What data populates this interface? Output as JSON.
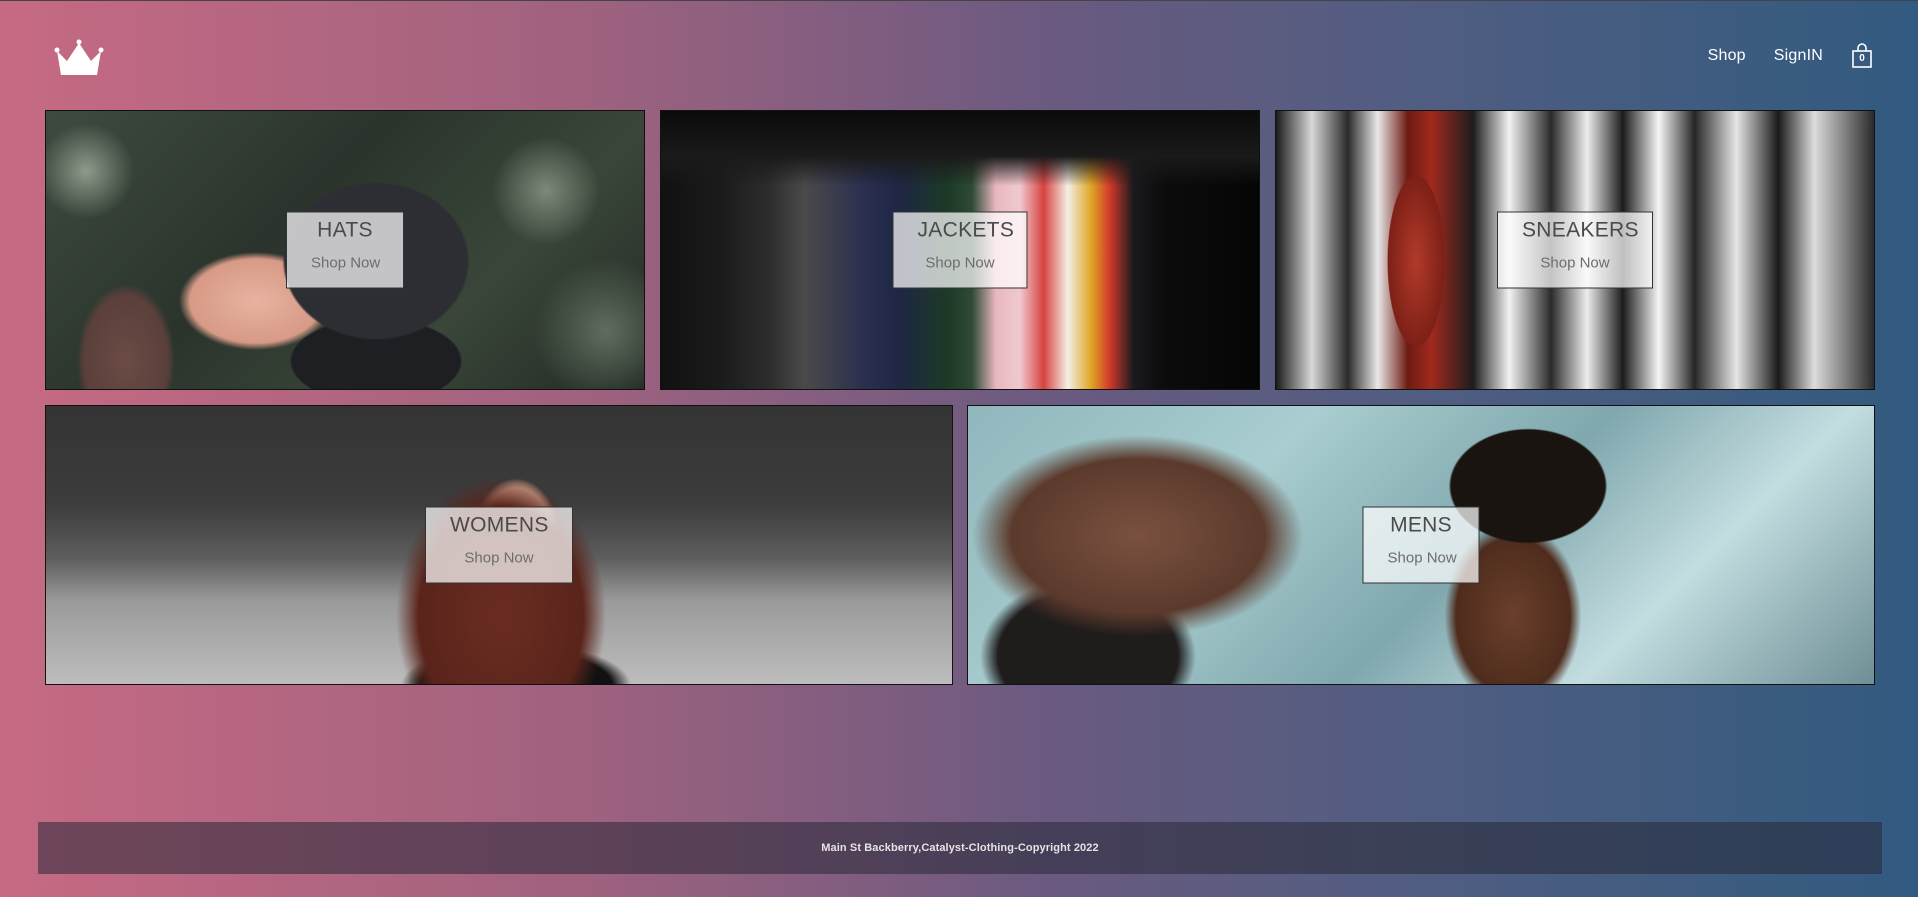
{
  "header": {
    "logo_icon": "crown-icon",
    "nav": {
      "shop_label": "Shop",
      "signin_label": "SignIN",
      "cart_icon": "shopping-bag-icon",
      "cart_count": "0"
    }
  },
  "categories": [
    {
      "title": "HATS",
      "action": "Shop Now"
    },
    {
      "title": "JACKETS",
      "action": "Shop Now"
    },
    {
      "title": "SNEAKERS",
      "action": "Shop Now"
    },
    {
      "title": "WOMENS",
      "action": "Shop Now"
    },
    {
      "title": "MENS",
      "action": "Shop Now"
    }
  ],
  "footer": {
    "text": "Main St Backberry,Catalyst-Clothing-Copyright 2022"
  },
  "colors": {
    "gradient_left": "#c76a83",
    "gradient_right": "#325a80",
    "label_box": "#ffffff",
    "nav_text": "#ffffff"
  }
}
